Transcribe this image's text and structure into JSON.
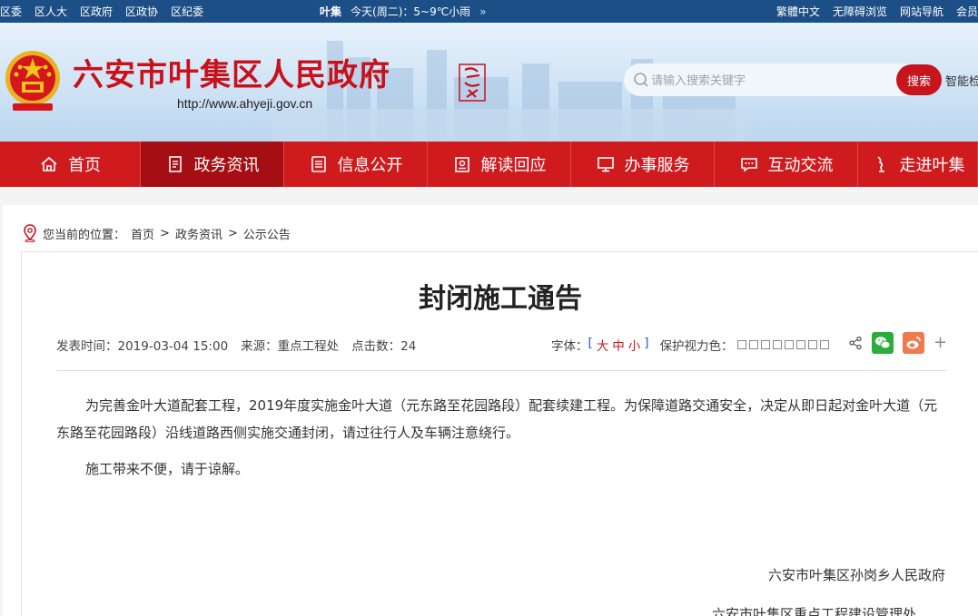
{
  "topbar": {
    "links": [
      "区委",
      "区人大",
      "区政府",
      "区政协",
      "区纪委"
    ],
    "weather_city": "叶集",
    "weather_text": "今天(周二)：5~9℃小雨",
    "right_links": [
      "繁體中文",
      "无障碍浏览",
      "网站导航",
      "会员"
    ]
  },
  "header": {
    "site_title": "六安市叶集区人民政府",
    "site_url": "http://www.ahyeji.gov.cn",
    "search_placeholder": "请输入搜索关键字",
    "search_button": "搜索",
    "smart_link": "智能检"
  },
  "nav": [
    {
      "label": "首页",
      "icon": "home-icon"
    },
    {
      "label": "政务资讯",
      "icon": "document-icon"
    },
    {
      "label": "信息公开",
      "icon": "list-icon"
    },
    {
      "label": "解读回应",
      "icon": "badge-icon"
    },
    {
      "label": "办事服务",
      "icon": "monitor-icon"
    },
    {
      "label": "互动交流",
      "icon": "chat-icon"
    },
    {
      "label": "走进叶集",
      "icon": "figure-icon"
    }
  ],
  "nav_active_index": 1,
  "breadcrumb": {
    "prefix": "您当前的位置：",
    "items": [
      "首页",
      "政务资讯",
      "公示公告"
    ],
    "separator": ">"
  },
  "article": {
    "title": "封闭施工通告",
    "publish_label": "发表时间：",
    "publish_time": "2019-03-04 15:00",
    "source_label": "来源：",
    "source": "重点工程处",
    "clicks_label": "点击数：",
    "clicks": "24",
    "font_label": "字体：",
    "font_options": [
      "大",
      "中",
      "小"
    ],
    "eye_color_label": "保护视力色：",
    "paragraphs": [
      "为完善金叶大道配套工程，2019年度实施金叶大道（元东路至花园路段）配套续建工程。为保障道路交通安全，决定从即日起对金叶大道（元东路至花园路段）沿线道路西侧实施交通封闭，请过往行人及车辆注意绕行。",
      "施工带来不便，请于谅解。"
    ],
    "signature_1": "六安市叶集区孙岗乡人民政府",
    "signature_2": "六安市叶集区重点工程建设管理处"
  },
  "colors": {
    "topbar": "#1b4f86",
    "brand_red": "#cf1a1e",
    "nav_active": "#a50e12",
    "wechat_green": "#2bad3b",
    "weibo_orange": "#f07a4c"
  }
}
